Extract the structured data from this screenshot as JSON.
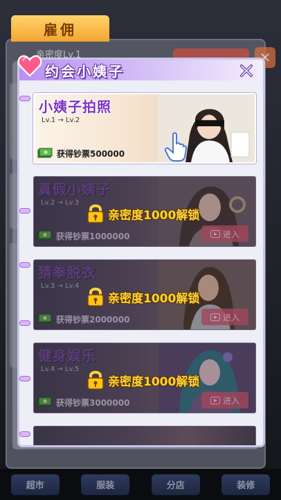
{
  "background": {
    "tab_label": "雇佣",
    "header_text": "亲密度Lv.1",
    "bottom_nav": [
      "超市",
      "服装",
      "分店",
      "装修"
    ]
  },
  "modal": {
    "title": "约会小姨子",
    "close_label": "✕",
    "colors": {
      "header_gradient_start": "#b990f2",
      "lock_text": "#ffd23a",
      "unlocked_name": "#7e34c2"
    }
  },
  "dates": [
    {
      "name": "小姨子拍照",
      "level": "Lv.1 → Lv.2",
      "reward": "获得钞票500000",
      "locked": false
    },
    {
      "name": "真假小姨子",
      "level": "Lv.2 → Lv.3",
      "reward": "获得钞票1000000",
      "locked": true,
      "lock_text": "亲密度1000解锁",
      "enter_label": "进入"
    },
    {
      "name": "猜拳脱衣",
      "level": "Lv.3 → Lv.4",
      "reward": "获得钞票2000000",
      "locked": true,
      "lock_text": "亲密度1000解锁",
      "enter_label": "进入"
    },
    {
      "name": "健身娱乐",
      "level": "Lv.4 → Lv.5",
      "reward": "获得钞票3000000",
      "locked": true,
      "lock_text": "亲密度1000解锁",
      "enter_label": "进入"
    }
  ]
}
